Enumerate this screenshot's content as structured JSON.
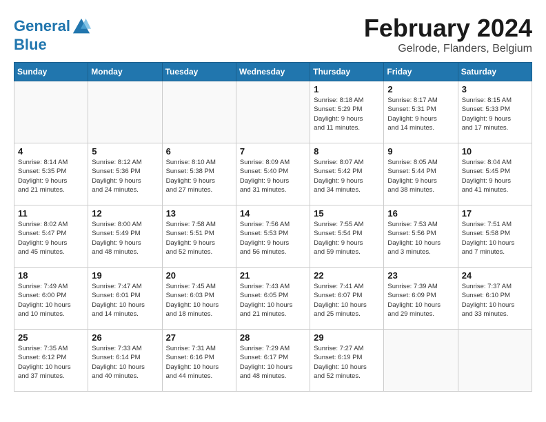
{
  "header": {
    "logo_line1": "General",
    "logo_line2": "Blue",
    "month_year": "February 2024",
    "location": "Gelrode, Flanders, Belgium"
  },
  "weekdays": [
    "Sunday",
    "Monday",
    "Tuesday",
    "Wednesday",
    "Thursday",
    "Friday",
    "Saturday"
  ],
  "weeks": [
    [
      {
        "day": "",
        "info": ""
      },
      {
        "day": "",
        "info": ""
      },
      {
        "day": "",
        "info": ""
      },
      {
        "day": "",
        "info": ""
      },
      {
        "day": "1",
        "info": "Sunrise: 8:18 AM\nSunset: 5:29 PM\nDaylight: 9 hours\nand 11 minutes."
      },
      {
        "day": "2",
        "info": "Sunrise: 8:17 AM\nSunset: 5:31 PM\nDaylight: 9 hours\nand 14 minutes."
      },
      {
        "day": "3",
        "info": "Sunrise: 8:15 AM\nSunset: 5:33 PM\nDaylight: 9 hours\nand 17 minutes."
      }
    ],
    [
      {
        "day": "4",
        "info": "Sunrise: 8:14 AM\nSunset: 5:35 PM\nDaylight: 9 hours\nand 21 minutes."
      },
      {
        "day": "5",
        "info": "Sunrise: 8:12 AM\nSunset: 5:36 PM\nDaylight: 9 hours\nand 24 minutes."
      },
      {
        "day": "6",
        "info": "Sunrise: 8:10 AM\nSunset: 5:38 PM\nDaylight: 9 hours\nand 27 minutes."
      },
      {
        "day": "7",
        "info": "Sunrise: 8:09 AM\nSunset: 5:40 PM\nDaylight: 9 hours\nand 31 minutes."
      },
      {
        "day": "8",
        "info": "Sunrise: 8:07 AM\nSunset: 5:42 PM\nDaylight: 9 hours\nand 34 minutes."
      },
      {
        "day": "9",
        "info": "Sunrise: 8:05 AM\nSunset: 5:44 PM\nDaylight: 9 hours\nand 38 minutes."
      },
      {
        "day": "10",
        "info": "Sunrise: 8:04 AM\nSunset: 5:45 PM\nDaylight: 9 hours\nand 41 minutes."
      }
    ],
    [
      {
        "day": "11",
        "info": "Sunrise: 8:02 AM\nSunset: 5:47 PM\nDaylight: 9 hours\nand 45 minutes."
      },
      {
        "day": "12",
        "info": "Sunrise: 8:00 AM\nSunset: 5:49 PM\nDaylight: 9 hours\nand 48 minutes."
      },
      {
        "day": "13",
        "info": "Sunrise: 7:58 AM\nSunset: 5:51 PM\nDaylight: 9 hours\nand 52 minutes."
      },
      {
        "day": "14",
        "info": "Sunrise: 7:56 AM\nSunset: 5:53 PM\nDaylight: 9 hours\nand 56 minutes."
      },
      {
        "day": "15",
        "info": "Sunrise: 7:55 AM\nSunset: 5:54 PM\nDaylight: 9 hours\nand 59 minutes."
      },
      {
        "day": "16",
        "info": "Sunrise: 7:53 AM\nSunset: 5:56 PM\nDaylight: 10 hours\nand 3 minutes."
      },
      {
        "day": "17",
        "info": "Sunrise: 7:51 AM\nSunset: 5:58 PM\nDaylight: 10 hours\nand 7 minutes."
      }
    ],
    [
      {
        "day": "18",
        "info": "Sunrise: 7:49 AM\nSunset: 6:00 PM\nDaylight: 10 hours\nand 10 minutes."
      },
      {
        "day": "19",
        "info": "Sunrise: 7:47 AM\nSunset: 6:01 PM\nDaylight: 10 hours\nand 14 minutes."
      },
      {
        "day": "20",
        "info": "Sunrise: 7:45 AM\nSunset: 6:03 PM\nDaylight: 10 hours\nand 18 minutes."
      },
      {
        "day": "21",
        "info": "Sunrise: 7:43 AM\nSunset: 6:05 PM\nDaylight: 10 hours\nand 21 minutes."
      },
      {
        "day": "22",
        "info": "Sunrise: 7:41 AM\nSunset: 6:07 PM\nDaylight: 10 hours\nand 25 minutes."
      },
      {
        "day": "23",
        "info": "Sunrise: 7:39 AM\nSunset: 6:09 PM\nDaylight: 10 hours\nand 29 minutes."
      },
      {
        "day": "24",
        "info": "Sunrise: 7:37 AM\nSunset: 6:10 PM\nDaylight: 10 hours\nand 33 minutes."
      }
    ],
    [
      {
        "day": "25",
        "info": "Sunrise: 7:35 AM\nSunset: 6:12 PM\nDaylight: 10 hours\nand 37 minutes."
      },
      {
        "day": "26",
        "info": "Sunrise: 7:33 AM\nSunset: 6:14 PM\nDaylight: 10 hours\nand 40 minutes."
      },
      {
        "day": "27",
        "info": "Sunrise: 7:31 AM\nSunset: 6:16 PM\nDaylight: 10 hours\nand 44 minutes."
      },
      {
        "day": "28",
        "info": "Sunrise: 7:29 AM\nSunset: 6:17 PM\nDaylight: 10 hours\nand 48 minutes."
      },
      {
        "day": "29",
        "info": "Sunrise: 7:27 AM\nSunset: 6:19 PM\nDaylight: 10 hours\nand 52 minutes."
      },
      {
        "day": "",
        "info": ""
      },
      {
        "day": "",
        "info": ""
      }
    ]
  ]
}
